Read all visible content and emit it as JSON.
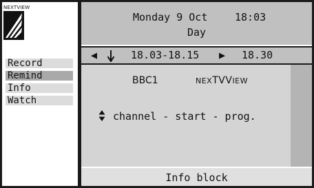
{
  "logo": {
    "label": "NEXTVIEW"
  },
  "menu": {
    "items": [
      {
        "label": "Record",
        "active": false
      },
      {
        "label": "Remind",
        "active": true
      },
      {
        "label": "Info",
        "active": false
      },
      {
        "label": "Watch",
        "active": false
      }
    ]
  },
  "header": {
    "date": "Monday 9 Oct",
    "time": "18:03",
    "view": "Day"
  },
  "nav": {
    "prev_icon": "left-arrow-icon",
    "down_icon": "down-arrow-icon",
    "current_slot": "18.03-18.15",
    "next_icon": "right-arrow-icon",
    "next_slot": "18.30"
  },
  "programme": {
    "channel": "BBC1",
    "source_prefix": "NEX",
    "source_tv": "TV",
    "source_suffix": "IEW",
    "hint": "channel - start - prog."
  },
  "footer": {
    "label": "Info block"
  },
  "colors": {
    "panel": "#c0c0c0",
    "content": "#d4d4d4",
    "active_menu": "#a9a9a9",
    "menu": "#dcdcdc",
    "frame": "#1a1a1a"
  }
}
